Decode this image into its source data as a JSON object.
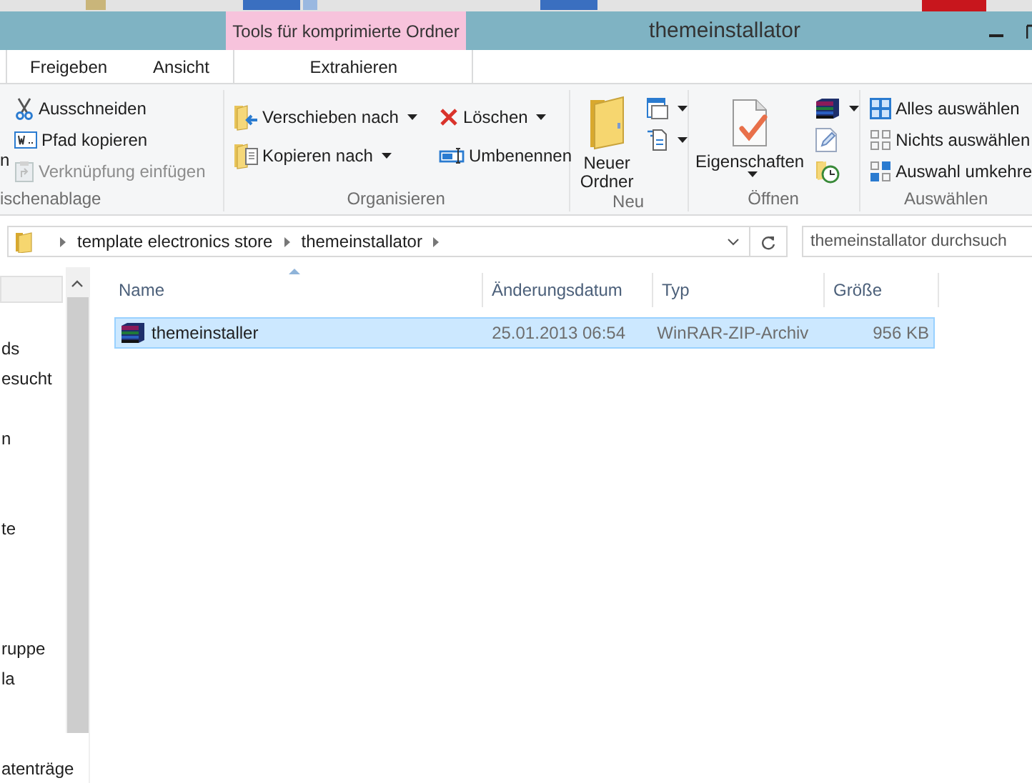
{
  "window": {
    "title": "themeinstallator",
    "context_group": "Tools für komprimierte Ordner"
  },
  "tabs": [
    {
      "label": "Freigeben",
      "selected": false
    },
    {
      "label": "Ansicht",
      "selected": false
    },
    {
      "label": "Extrahieren",
      "selected": false,
      "kind": "context"
    }
  ],
  "ribbon": {
    "groups": [
      {
        "label": "ischenablage",
        "partial_label": "n",
        "items": [
          {
            "label": "Ausschneiden",
            "disabled": false
          },
          {
            "label": "Pfad kopieren",
            "disabled": false
          },
          {
            "label": "Verknüpfung einfügen",
            "disabled": true
          }
        ]
      },
      {
        "label": "Organisieren",
        "items": [
          {
            "label": "Verschieben nach",
            "dropdown": true
          },
          {
            "label": "Kopieren nach",
            "dropdown": true
          },
          {
            "label": "Löschen",
            "dropdown": true
          },
          {
            "label": "Umbenennen",
            "dropdown": false
          }
        ]
      },
      {
        "label": "Neu",
        "big": {
          "label": "Neuer Ordner",
          "dropdown": false
        },
        "items": [
          {
            "dropdown": true
          },
          {
            "dropdown": true
          }
        ]
      },
      {
        "label": "Öffnen",
        "big": {
          "label": "Eigenschaften",
          "dropdown": true
        },
        "items": [
          {
            "dropdown": true
          },
          {
            "dropdown": false
          },
          {
            "dropdown": false
          }
        ]
      },
      {
        "label": "Auswählen",
        "items": [
          {
            "label": "Alles auswählen"
          },
          {
            "label": "Nichts auswählen"
          },
          {
            "label": "Auswahl umkehre"
          }
        ]
      }
    ]
  },
  "address": {
    "crumbs": [
      "template electronics store",
      "themeinstallator"
    ],
    "search_placeholder": "themeinstallator durchsuch"
  },
  "nav": {
    "items": [
      {
        "selected": true
      },
      {
        "label": "ds",
        "selected": false
      },
      {
        "label": "esucht",
        "selected": false
      },
      {
        "label": "n",
        "selected": false
      },
      {
        "label": "te",
        "selected": false
      },
      {
        "label": "ruppe",
        "selected": false
      },
      {
        "label": "la",
        "selected": false
      },
      {
        "label": "atenträge",
        "selected": false
      }
    ]
  },
  "table": {
    "columns": [
      "Name",
      "Änderungsdatum",
      "Typ",
      "Größe"
    ],
    "rows": [
      {
        "cells": [
          "themeinstaller",
          "25.01.2013 06:54",
          "WinRAR-ZIP-Archiv",
          "956 KB"
        ],
        "selected": true
      }
    ]
  }
}
